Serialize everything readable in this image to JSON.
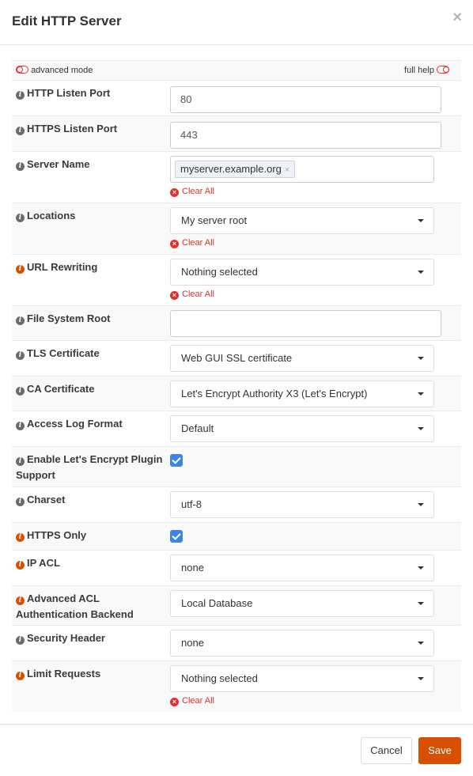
{
  "header": {
    "title": "Edit HTTP Server",
    "close_label": "×"
  },
  "toggles": {
    "advanced_mode": "advanced mode",
    "full_help": "full help"
  },
  "clear_all_label": "Clear All",
  "fields": [
    {
      "label": "HTTP Listen Port",
      "type": "text",
      "value": "80",
      "advanced": false
    },
    {
      "label": "HTTPS Listen Port",
      "type": "text",
      "value": "443",
      "advanced": false
    },
    {
      "label": "Server Name",
      "type": "tags",
      "tags": [
        "myserver.example.org"
      ],
      "advanced": false
    },
    {
      "label": "Locations",
      "type": "select",
      "value": "My server root",
      "advanced": false
    },
    {
      "label": "URL Rewriting",
      "type": "select",
      "value": "Nothing selected",
      "advanced": true
    },
    {
      "label": "File System Root",
      "type": "text",
      "value": "",
      "advanced": false
    },
    {
      "label": "TLS Certificate",
      "type": "select",
      "value": "Web GUI SSL certificate",
      "advanced": false
    },
    {
      "label": "CA Certificate",
      "type": "select",
      "value": "Let's Encrypt Authority X3 (Let's Encrypt)",
      "advanced": false
    },
    {
      "label": "Access Log Format",
      "type": "select",
      "value": "Default",
      "advanced": false
    },
    {
      "label": "Enable Let's Encrypt Plugin Support",
      "type": "checkbox",
      "checked": true,
      "advanced": false
    },
    {
      "label": "Charset",
      "type": "select",
      "value": "utf-8",
      "advanced": false
    },
    {
      "label": "HTTPS Only",
      "type": "checkbox",
      "checked": true,
      "advanced": true
    },
    {
      "label": "IP ACL",
      "type": "select",
      "value": "none",
      "advanced": true
    },
    {
      "label": "Advanced ACL Authentication Backend",
      "type": "select",
      "value": "Local Database",
      "advanced": true
    },
    {
      "label": "Security Header",
      "type": "select",
      "value": "none",
      "advanced": false
    },
    {
      "label": "Limit Requests",
      "type": "select",
      "value": "Nothing selected",
      "advanced": true
    }
  ],
  "footer": {
    "cancel_label": "Cancel",
    "save_label": "Save"
  },
  "colors": {
    "accent": "#d94f00",
    "danger": "#e0312b",
    "checkbox": "#3b86e0"
  }
}
